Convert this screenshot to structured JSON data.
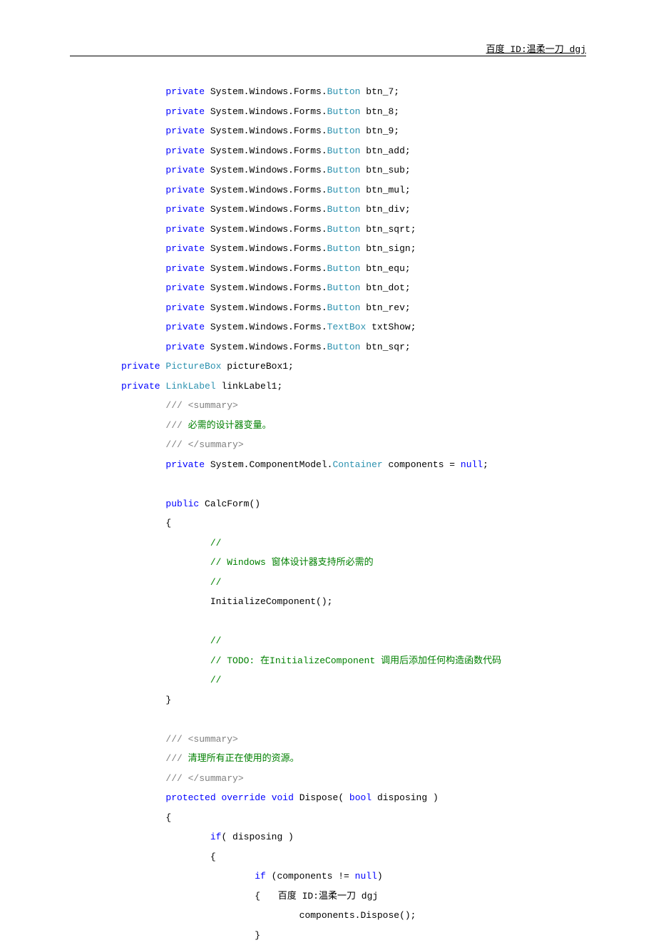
{
  "header": "百度 ID:温柔一刀 dgj",
  "footer": "百度 ID:温柔一刀 dgj",
  "code": {
    "lines": [
      {
        "indent": 2,
        "tokens": [
          {
            "t": "kw",
            "v": "private"
          },
          {
            "t": "plain",
            "v": " System.Windows.Forms."
          },
          {
            "t": "type",
            "v": "Button"
          },
          {
            "t": "plain",
            "v": " btn_7;"
          }
        ]
      },
      {
        "indent": 2,
        "tokens": [
          {
            "t": "kw",
            "v": "private"
          },
          {
            "t": "plain",
            "v": " System.Windows.Forms."
          },
          {
            "t": "type",
            "v": "Button"
          },
          {
            "t": "plain",
            "v": " btn_8;"
          }
        ]
      },
      {
        "indent": 2,
        "tokens": [
          {
            "t": "kw",
            "v": "private"
          },
          {
            "t": "plain",
            "v": " System.Windows.Forms."
          },
          {
            "t": "type",
            "v": "Button"
          },
          {
            "t": "plain",
            "v": " btn_9;"
          }
        ]
      },
      {
        "indent": 2,
        "tokens": [
          {
            "t": "kw",
            "v": "private"
          },
          {
            "t": "plain",
            "v": " System.Windows.Forms."
          },
          {
            "t": "type",
            "v": "Button"
          },
          {
            "t": "plain",
            "v": " btn_add;"
          }
        ]
      },
      {
        "indent": 2,
        "tokens": [
          {
            "t": "kw",
            "v": "private"
          },
          {
            "t": "plain",
            "v": " System.Windows.Forms."
          },
          {
            "t": "type",
            "v": "Button"
          },
          {
            "t": "plain",
            "v": " btn_sub;"
          }
        ]
      },
      {
        "indent": 2,
        "tokens": [
          {
            "t": "kw",
            "v": "private"
          },
          {
            "t": "plain",
            "v": " System.Windows.Forms."
          },
          {
            "t": "type",
            "v": "Button"
          },
          {
            "t": "plain",
            "v": " btn_mul;"
          }
        ]
      },
      {
        "indent": 2,
        "tokens": [
          {
            "t": "kw",
            "v": "private"
          },
          {
            "t": "plain",
            "v": " System.Windows.Forms."
          },
          {
            "t": "type",
            "v": "Button"
          },
          {
            "t": "plain",
            "v": " btn_div;"
          }
        ]
      },
      {
        "indent": 2,
        "tokens": [
          {
            "t": "kw",
            "v": "private"
          },
          {
            "t": "plain",
            "v": " System.Windows.Forms."
          },
          {
            "t": "type",
            "v": "Button"
          },
          {
            "t": "plain",
            "v": " btn_sqrt;"
          }
        ]
      },
      {
        "indent": 2,
        "tokens": [
          {
            "t": "kw",
            "v": "private"
          },
          {
            "t": "plain",
            "v": " System.Windows.Forms."
          },
          {
            "t": "type",
            "v": "Button"
          },
          {
            "t": "plain",
            "v": " btn_sign;"
          }
        ]
      },
      {
        "indent": 2,
        "tokens": [
          {
            "t": "kw",
            "v": "private"
          },
          {
            "t": "plain",
            "v": " System.Windows.Forms."
          },
          {
            "t": "type",
            "v": "Button"
          },
          {
            "t": "plain",
            "v": " btn_equ;"
          }
        ]
      },
      {
        "indent": 2,
        "tokens": [
          {
            "t": "kw",
            "v": "private"
          },
          {
            "t": "plain",
            "v": " System.Windows.Forms."
          },
          {
            "t": "type",
            "v": "Button"
          },
          {
            "t": "plain",
            "v": " btn_dot;"
          }
        ]
      },
      {
        "indent": 2,
        "tokens": [
          {
            "t": "kw",
            "v": "private"
          },
          {
            "t": "plain",
            "v": " System.Windows.Forms."
          },
          {
            "t": "type",
            "v": "Button"
          },
          {
            "t": "plain",
            "v": " btn_rev;"
          }
        ]
      },
      {
        "indent": 2,
        "tokens": [
          {
            "t": "kw",
            "v": "private"
          },
          {
            "t": "plain",
            "v": " System.Windows.Forms."
          },
          {
            "t": "type",
            "v": "TextBox"
          },
          {
            "t": "plain",
            "v": " txtShow;"
          }
        ]
      },
      {
        "indent": 2,
        "tokens": [
          {
            "t": "kw",
            "v": "private"
          },
          {
            "t": "plain",
            "v": " System.Windows.Forms."
          },
          {
            "t": "type",
            "v": "Button"
          },
          {
            "t": "plain",
            "v": " btn_sqr;"
          }
        ]
      },
      {
        "indent": 0,
        "tokens": [
          {
            "t": "kw",
            "v": "private"
          },
          {
            "t": "plain",
            "v": " "
          },
          {
            "t": "type",
            "v": "PictureBox"
          },
          {
            "t": "plain",
            "v": " pictureBox1;"
          }
        ]
      },
      {
        "indent": 0,
        "tokens": [
          {
            "t": "kw",
            "v": "private"
          },
          {
            "t": "plain",
            "v": " "
          },
          {
            "t": "type",
            "v": "LinkLabel"
          },
          {
            "t": "plain",
            "v": " linkLabel1;"
          }
        ]
      },
      {
        "indent": 2,
        "tokens": [
          {
            "t": "comment",
            "v": "///"
          },
          {
            "t": "comment",
            "v": " <summary>"
          }
        ]
      },
      {
        "indent": 2,
        "tokens": [
          {
            "t": "comment",
            "v": "///"
          },
          {
            "t": "doc",
            "v": " 必需的设计器变量。"
          }
        ]
      },
      {
        "indent": 2,
        "tokens": [
          {
            "t": "comment",
            "v": "///"
          },
          {
            "t": "comment",
            "v": " </summary>"
          }
        ]
      },
      {
        "indent": 2,
        "tokens": [
          {
            "t": "kw",
            "v": "private"
          },
          {
            "t": "plain",
            "v": " System.ComponentModel."
          },
          {
            "t": "type",
            "v": "Container"
          },
          {
            "t": "plain",
            "v": " components = "
          },
          {
            "t": "kw",
            "v": "null"
          },
          {
            "t": "plain",
            "v": ";"
          }
        ]
      },
      {
        "indent": 0,
        "tokens": []
      },
      {
        "indent": 2,
        "tokens": [
          {
            "t": "kw",
            "v": "public"
          },
          {
            "t": "plain",
            "v": " CalcForm()"
          }
        ]
      },
      {
        "indent": 2,
        "tokens": [
          {
            "t": "plain",
            "v": "{"
          }
        ]
      },
      {
        "indent": 4,
        "tokens": [
          {
            "t": "doc",
            "v": "//"
          }
        ]
      },
      {
        "indent": 4,
        "tokens": [
          {
            "t": "doc",
            "v": "// Windows 窗体设计器支持所必需的"
          }
        ]
      },
      {
        "indent": 4,
        "tokens": [
          {
            "t": "doc",
            "v": "//"
          }
        ]
      },
      {
        "indent": 4,
        "tokens": [
          {
            "t": "plain",
            "v": "InitializeComponent();"
          }
        ]
      },
      {
        "indent": 0,
        "tokens": []
      },
      {
        "indent": 4,
        "tokens": [
          {
            "t": "doc",
            "v": "//"
          }
        ]
      },
      {
        "indent": 4,
        "tokens": [
          {
            "t": "doc",
            "v": "// TODO: 在InitializeComponent 调用后添加任何构造函数代码"
          }
        ]
      },
      {
        "indent": 4,
        "tokens": [
          {
            "t": "doc",
            "v": "//"
          }
        ]
      },
      {
        "indent": 2,
        "tokens": [
          {
            "t": "plain",
            "v": "}"
          }
        ]
      },
      {
        "indent": 0,
        "tokens": []
      },
      {
        "indent": 2,
        "tokens": [
          {
            "t": "comment",
            "v": "///"
          },
          {
            "t": "comment",
            "v": " <summary>"
          }
        ]
      },
      {
        "indent": 2,
        "tokens": [
          {
            "t": "comment",
            "v": "///"
          },
          {
            "t": "doc",
            "v": " 清理所有正在使用的资源。"
          }
        ]
      },
      {
        "indent": 2,
        "tokens": [
          {
            "t": "comment",
            "v": "///"
          },
          {
            "t": "comment",
            "v": " </summary>"
          }
        ]
      },
      {
        "indent": 2,
        "tokens": [
          {
            "t": "kw",
            "v": "protected"
          },
          {
            "t": "plain",
            "v": " "
          },
          {
            "t": "kw",
            "v": "override"
          },
          {
            "t": "plain",
            "v": " "
          },
          {
            "t": "kw",
            "v": "void"
          },
          {
            "t": "plain",
            "v": " Dispose( "
          },
          {
            "t": "kw",
            "v": "bool"
          },
          {
            "t": "plain",
            "v": " disposing )"
          }
        ]
      },
      {
        "indent": 2,
        "tokens": [
          {
            "t": "plain",
            "v": "{"
          }
        ]
      },
      {
        "indent": 4,
        "tokens": [
          {
            "t": "kw",
            "v": "if"
          },
          {
            "t": "plain",
            "v": "( disposing )"
          }
        ]
      },
      {
        "indent": 4,
        "tokens": [
          {
            "t": "plain",
            "v": "{"
          }
        ]
      },
      {
        "indent": 6,
        "tokens": [
          {
            "t": "kw",
            "v": "if"
          },
          {
            "t": "plain",
            "v": " (components != "
          },
          {
            "t": "kw",
            "v": "null"
          },
          {
            "t": "plain",
            "v": ")"
          }
        ]
      },
      {
        "indent": 6,
        "tokens": [
          {
            "t": "plain",
            "v": "{"
          }
        ]
      },
      {
        "indent": 8,
        "tokens": [
          {
            "t": "plain",
            "v": "components.Dispose();"
          }
        ]
      },
      {
        "indent": 6,
        "tokens": [
          {
            "t": "plain",
            "v": "}"
          }
        ]
      }
    ]
  }
}
